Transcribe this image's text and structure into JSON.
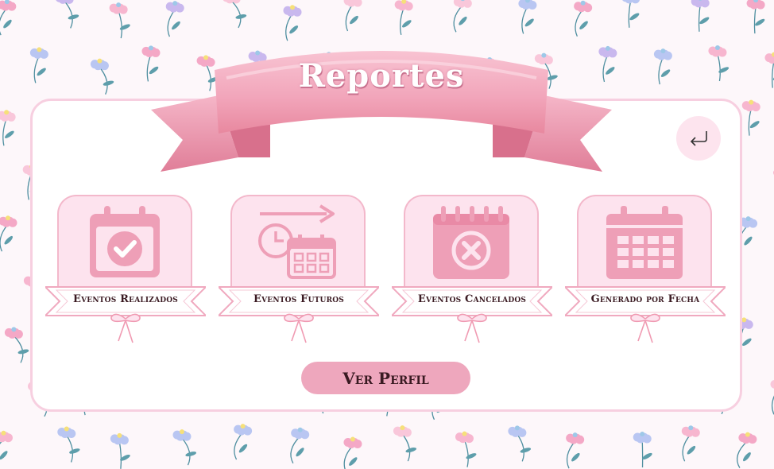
{
  "header": {
    "title": "Reportes"
  },
  "nav": {
    "back_icon": "return-arrow-icon"
  },
  "cards": [
    {
      "label": "Eventos Realizados",
      "icon": "calendar-check-icon"
    },
    {
      "label": "Eventos Futuros",
      "icon": "calendar-clock-arrow-icon"
    },
    {
      "label": "Eventos Cancelados",
      "icon": "calendar-cancel-icon"
    },
    {
      "label": "Generado por Fecha",
      "icon": "calendar-grid-icon"
    }
  ],
  "footer": {
    "profile_label": "Ver Perfil"
  },
  "colors": {
    "panel_border": "#f7cfe0",
    "card_fill": "#fde3ee",
    "icon_pink": "#ee9fb7",
    "button_fill": "#eea7bd",
    "text_dark": "#3a1a22"
  }
}
